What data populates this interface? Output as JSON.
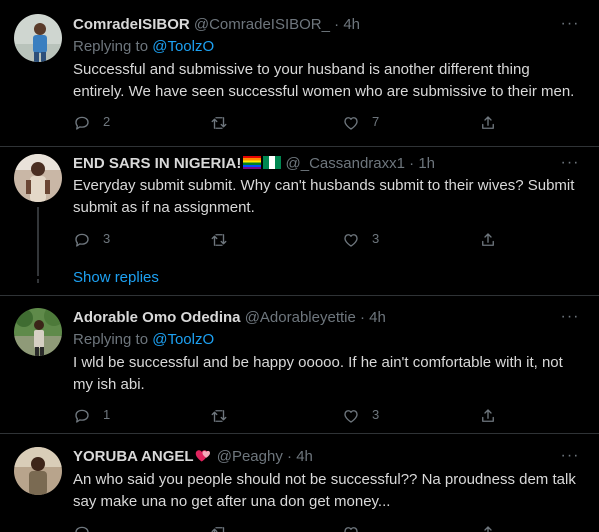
{
  "tweets": [
    {
      "name": "ComradeISIBOR",
      "handle": "@ComradeISIBOR_",
      "dot": "·",
      "time": "4h",
      "replying_label": "Replying to",
      "replying_to": "@ToolzO",
      "text": "Successful and submissive to your husband is another different thing entirely. We have seen successful women who are submissive to their men.",
      "counts": {
        "reply": "2",
        "retweet": "",
        "like": "7"
      }
    },
    {
      "name": "END SARS IN NIGERIA!",
      "handle": "@_Cassandraxx1",
      "dot": "·",
      "time": "1h",
      "text": "Everyday submit submit. Why can't husbands submit to their wives? Submit submit as if na assignment.",
      "counts": {
        "reply": "3",
        "retweet": "",
        "like": "3"
      }
    },
    {
      "name": "Adorable Omo Odedina",
      "handle": "@Adorableyettie",
      "dot": "·",
      "time": "4h",
      "replying_label": "Replying to",
      "replying_to": "@ToolzO",
      "text": "I wld be successful and be happy ooooo. If he ain't comfortable with it, not my ish abi.",
      "counts": {
        "reply": "1",
        "retweet": "",
        "like": "3"
      }
    },
    {
      "name": "YORUBA ANGEL",
      "handle": "@Peaghy",
      "dot": "·",
      "time": "4h",
      "text": "An who said you people should not be successful?? Na proudness dem talk say make una no get after una don get money...",
      "counts": {
        "reply": "",
        "retweet": "",
        "like": ""
      }
    }
  ],
  "show_replies": "Show replies",
  "more_label": "···",
  "colors": {
    "background": "#000000",
    "text": "#d9d9d9",
    "muted": "#6e767d",
    "accent": "#1da1f2",
    "divider": "#2f3336"
  },
  "icons": [
    "reply-icon",
    "retweet-icon",
    "like-icon",
    "share-icon",
    "more-icon",
    "rainbow-flag-icon",
    "nigeria-flag-icon",
    "heart-emoji-icon"
  ]
}
